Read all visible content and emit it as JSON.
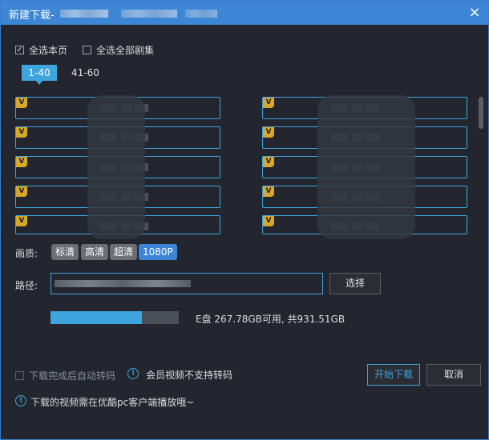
{
  "window": {
    "title": "新建下载-",
    "close_glyph": "×"
  },
  "select": {
    "page_label": "全选本页",
    "page_checked": true,
    "all_label": "全选全部剧集",
    "all_checked": false
  },
  "tabs": [
    {
      "label": "1-40",
      "active": true
    },
    {
      "label": "41-60",
      "active": false
    }
  ],
  "episodes": {
    "badge": "V",
    "count_visible": 10
  },
  "quality": {
    "label": "画质:",
    "options": [
      {
        "label": "标清",
        "selected": false
      },
      {
        "label": "高清",
        "selected": false
      },
      {
        "label": "超清",
        "selected": false
      },
      {
        "label": "1080P",
        "selected": true
      }
    ]
  },
  "path": {
    "label": "路径:",
    "value": "",
    "browse_label": "选择"
  },
  "disk": {
    "used_fraction": 0.71,
    "text": "E盘 267.78GB可用, 共931.51GB"
  },
  "bottom": {
    "auto_transcode_label": "下载完成后自动转码",
    "auto_transcode_checked": false,
    "vip_note": "会员视频不支持转码",
    "start_label": "开始下载",
    "cancel_label": "取消",
    "footer_note": "下载的视频需在优酷pc客户端播放哦~",
    "info_glyph": "!"
  },
  "colors": {
    "accent": "#3fa5de",
    "titlebar": "#3d86d6",
    "background": "#23262e",
    "vip_badge": "#d7a829"
  }
}
